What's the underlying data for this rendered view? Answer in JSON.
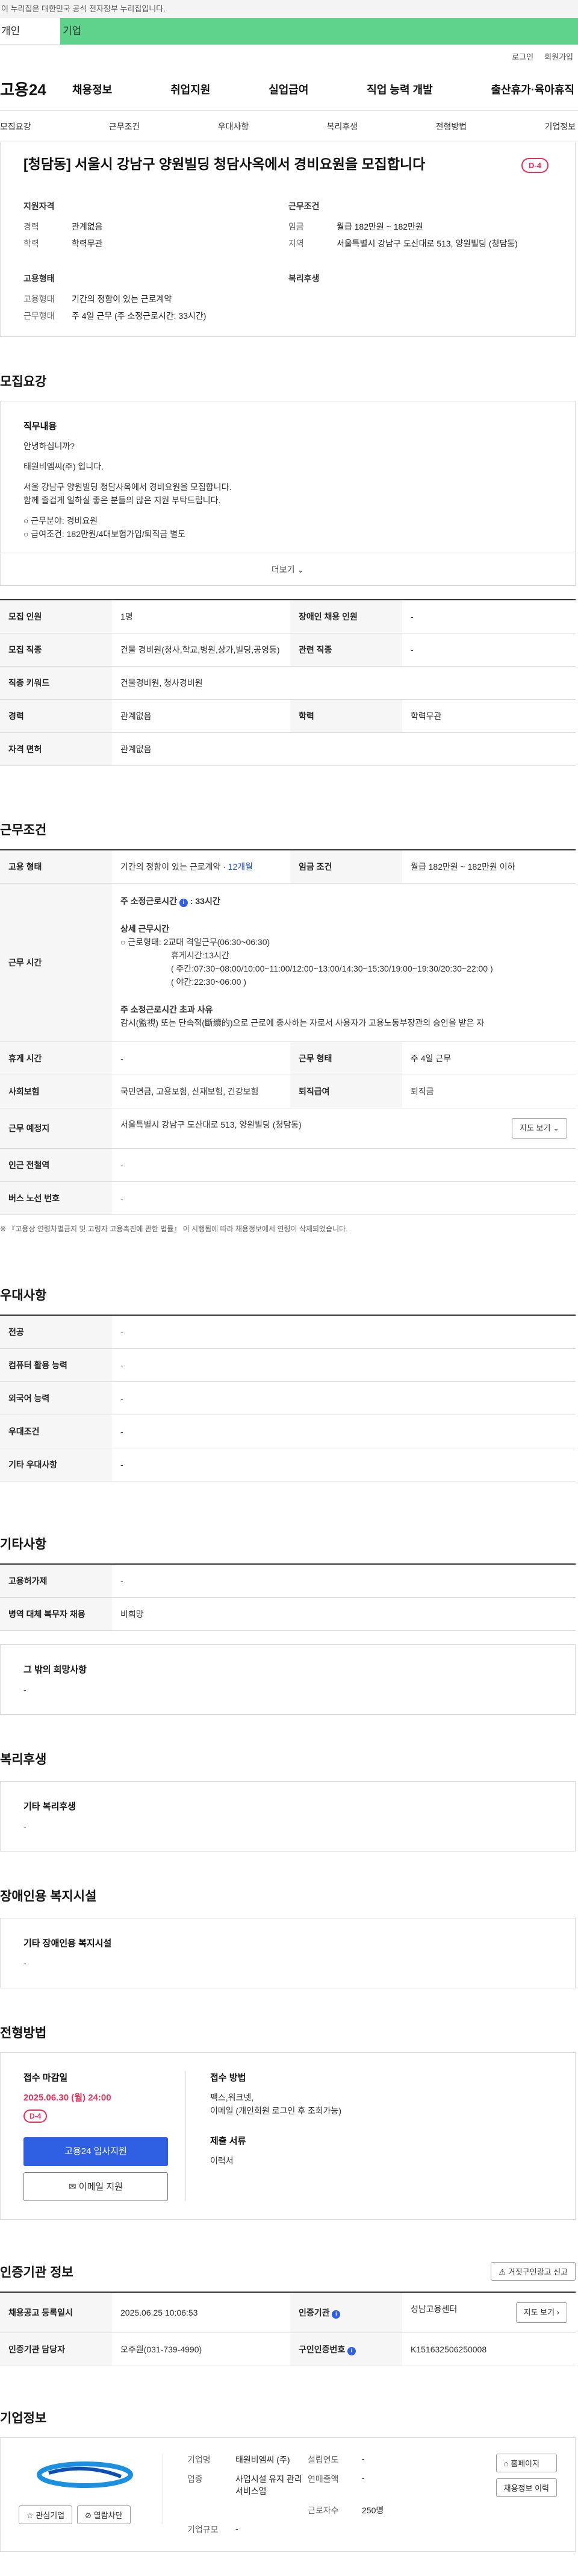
{
  "gov_notice": "이 누리집은 대한민국 공식 전자정부 누리집입니다.",
  "user_tabs": {
    "personal": "개인",
    "company": "기업"
  },
  "util": {
    "login": "로그인",
    "join": "회원가입"
  },
  "logo": "고용24",
  "gnb": [
    "채용정보",
    "취업지원",
    "실업급여",
    "직업 능력 개발",
    "출산휴가·육아휴직"
  ],
  "anchor_nav": [
    "모집요강",
    "근무조건",
    "우대사항",
    "복리후생",
    "전형방법",
    "기업정보"
  ],
  "header": {
    "title": "[청담동] 서울시 강남구 양원빌딩 청담사옥에서 경비요원을 모집합니다",
    "dday": "D-4",
    "qual_h": "지원자격",
    "career_k": "경력",
    "career_v": "관계없음",
    "edu_k": "학력",
    "edu_v": "학력무관",
    "emp_h": "고용형태",
    "emptype_k": "고용형태",
    "emptype_v": "기간의 정함이 있는 근로계약",
    "worktype_k": "근무형태",
    "worktype_v": "주 4일 근무 (주 소정근로시간: 33시간)",
    "cond_h": "근무조건",
    "wage_k": "임금",
    "wage_v": "월급 182만원 ~ 182만원",
    "area_k": "지역",
    "area_v": "서울특별시 강남구 도산대로 513, 양원빌딩 (청담동)",
    "welfare_h": "복리후생"
  },
  "recruit": {
    "title": "모집요강",
    "duty_h": "직무내용",
    "lines": [
      "안녕하십니까?",
      "태원비엠씨(주) 입니다.",
      "서울 강남구 양원빌딩 청담사옥에서 경비요원을 모집합니다.",
      "함께 즐겁게 일하실 좋은 분들의 많은 지원 부탁드립니다.",
      "○ 근무분야: 경비요원",
      "○ 급여조건: 182만원/4대보험가입/퇴직금 별도"
    ],
    "more": "더보기",
    "table": {
      "k1": "모집 인원",
      "v1": "1명",
      "k2": "장애인 채용 인원",
      "v2": "-",
      "k3": "모집 직종",
      "v3": "건물 경비원(청사,학교,병원,상가,빌딩,공영등)",
      "k4": "관련 직종",
      "v4": "-",
      "k5": "직종 키워드",
      "v5": "건물경비원, 청사경비원",
      "k6": "경력",
      "v6": "관계없음",
      "k7": "학력",
      "v7": "학력무관",
      "k8": "자격 면허",
      "v8": "관계없음"
    }
  },
  "work": {
    "title": "근무조건",
    "emp_k": "고용 형태",
    "emp_v": "기간의 정함이 있는 근로계약 ·",
    "emp_period": "12개월",
    "wage_k": "임금 조건",
    "wage_v": "월급 182만원 ~ 182만원 이하",
    "hours_k": "근무 시간",
    "hours_h": "주 소정근로시간",
    "hours_total": ": 33시간",
    "detail_h": "상세 근무시간",
    "detail_lines": [
      "○ 근로형태: 2교대 격일근무(06:30~06:30)",
      "휴게시간:13시간",
      "( 주간:07:30~08:00/10:00~11:00/12:00~13:00/14:30~15:30/19:00~19:30/20:30~22:00 )",
      "( 야간:22:30~06:00 )"
    ],
    "over_h": "주 소정근로시간 초과 사유",
    "over_v": "감시(監視) 또는 단속적(斷續的)으로 근로에 종사하는 자로서 사용자가 고용노동부장관의 승인을 받은 자",
    "rest_k": "휴게 시간",
    "rest_v": "-",
    "worktype_k": "근무 형태",
    "worktype_v": "주 4일 근무",
    "ins_k": "사회보험",
    "ins_v": "국민연금, 고용보험, 산재보험, 건강보험",
    "sev_k": "퇴직급여",
    "sev_v": "퇴직금",
    "place_k": "근무 예정지",
    "place_v": "서울특별시 강남구 도산대로 513, 양원빌딩 (청담동)",
    "map_btn": "지도 보기",
    "subway_k": "인근 전철역",
    "subway_v": "-",
    "bus_k": "버스 노선 번호",
    "bus_v": "-",
    "note": "※ 『고용상 연령차별금지 및 고령자 고용촉진에 관한 법률』 이 시행됨에 따라 채용정보에서 연령이 삭제되었습니다."
  },
  "pref": {
    "title": "우대사항",
    "rows": [
      [
        "전공",
        "-"
      ],
      [
        "컴퓨터 활용 능력",
        "-"
      ],
      [
        "외국어 능력",
        "-"
      ],
      [
        "우대조건",
        "-"
      ],
      [
        "기타 우대사항",
        "-"
      ]
    ]
  },
  "etc": {
    "title": "기타사항",
    "rows": [
      [
        "고용허가제",
        "-"
      ],
      [
        "병역 대체 복무자 채용",
        "비희망"
      ]
    ],
    "other_h": "그 밖의 희망사항",
    "other_v": "-"
  },
  "welfare": {
    "title": "복리후생",
    "h": "기타 복리후생",
    "v": "-"
  },
  "disabled": {
    "title": "장애인용 복지시설",
    "h": "기타 장애인용 복지시설",
    "v": "-"
  },
  "apply": {
    "title": "전형방법",
    "deadline_h": "접수 마감일",
    "deadline_v": "2025.06.30 (월) 24:00",
    "dday": "D-4",
    "btn_apply": "고용24 입사지원",
    "btn_email": "이메일 지원",
    "method_h": "접수 방법",
    "method_v1": "팩스,워크넷,",
    "method_v2": "이메일 (개인회원 로그인 후 조회가능)",
    "docs_h": "제출 서류",
    "docs_v": "이력서"
  },
  "cert": {
    "title": "인증기관 정보",
    "report_btn": "거짓구인광고 신고",
    "k1": "채용공고 등록일시",
    "v1": "2025.06.25 10:06:53",
    "k2": "인증기관",
    "v2": "성남고용센터",
    "map_btn": "지도 보기",
    "k3": "인증기관 담당자",
    "v3": "오주원(031-739-4990)",
    "k4": "구인인증번호",
    "v4": "K151632506250008"
  },
  "company": {
    "title": "기업정보",
    "name_k": "기업명",
    "name_v": "태원비엠씨 (주)",
    "year_k": "설립연도",
    "year_v": "-",
    "ind_k": "업종",
    "ind_v": "사업시설 유지 관리 서비스업",
    "sales_k": "연매출액",
    "sales_v": "-",
    "emp_k": "근로자수",
    "emp_v": "250명",
    "size_k": "기업규모",
    "size_v": "-",
    "fav_btn": "관심기업",
    "block_btn": "열람차단",
    "home_btn": "홈페이지",
    "list_btn": "채용정보 이력"
  }
}
